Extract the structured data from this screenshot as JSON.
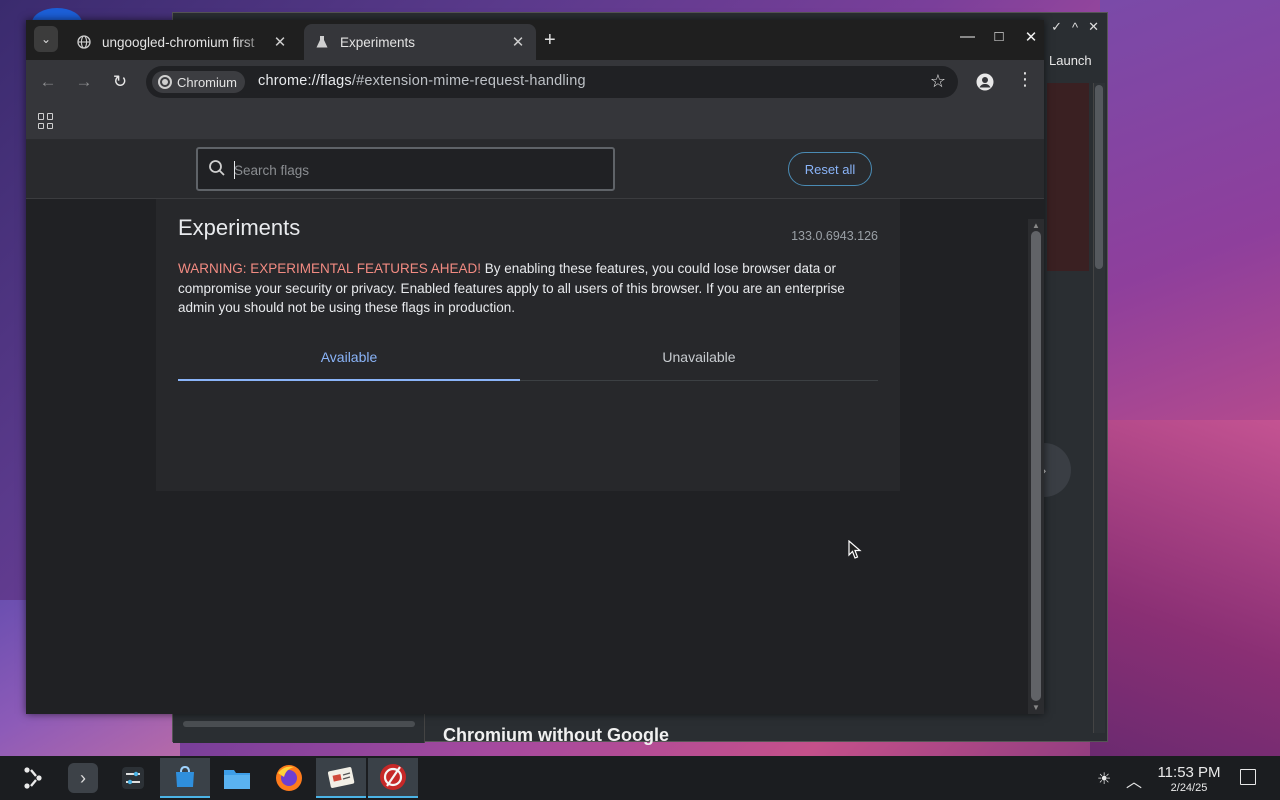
{
  "background_window": {
    "launch_label": "Launch",
    "heading": "Chromium without Google",
    "controls": [
      "✓",
      "^",
      "✕"
    ]
  },
  "browser": {
    "tabs": [
      {
        "title": "ungoogled-chromium first",
        "icon": "globe-icon",
        "active": false
      },
      {
        "title": "Experiments",
        "icon": "flask-icon",
        "active": true
      }
    ],
    "new_tab_label": "+",
    "window_controls": {
      "minimize": "—",
      "maximize": "□",
      "close": "✕"
    },
    "chip_label": "Chromium",
    "url_host": "chrome://flags",
    "url_path": "/#extension-mime-request-handling"
  },
  "flags_page": {
    "search_placeholder": "Search flags",
    "reset_label": "Reset all",
    "title": "Experiments",
    "version": "133.0.6943.126",
    "warning_label": "WARNING: EXPERIMENTAL FEATURES AHEAD!",
    "warning_text": " By enabling these features, you could lose browser data or compromise your security or privacy. Enabled features apply to all users of this browser. If you are an enterprise admin you should not be using these flags in production.",
    "tabs": [
      {
        "label": "Available",
        "selected": true
      },
      {
        "label": "Unavailable",
        "selected": false
      }
    ]
  },
  "taskbar": {
    "time": "11:53 PM",
    "date": "2/24/25",
    "apps": [
      "application-launcher-icon",
      "terminal-icon",
      "settings-icon",
      "discover-icon",
      "files-icon",
      "firefox-icon",
      "card-icon",
      "chromium-icon"
    ]
  },
  "colors": {
    "accent": "#8ab4f8",
    "warning": "#f28b82",
    "page_bg": "#202124"
  }
}
